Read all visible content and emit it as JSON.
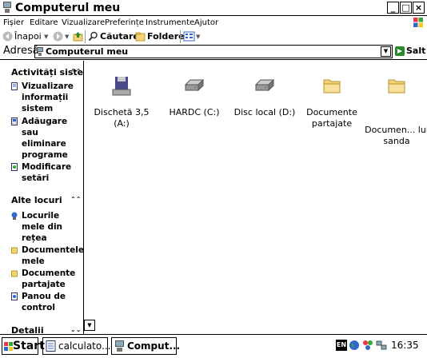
{
  "window": {
    "title": "Computerul meu",
    "buttons": {
      "minimize": "_",
      "maximize": "□",
      "close": "×"
    }
  },
  "menu": {
    "items": [
      "Fișier",
      "Editare",
      "Vizualizare",
      "Preferințe",
      "Instrumente",
      "Ajutor"
    ]
  },
  "toolbar": {
    "back_label": "Înapoi",
    "search_label": "Căutare",
    "folders_label": "Foldere",
    "dropdown_caret": "▼"
  },
  "address": {
    "label": "Adresă",
    "value": "Computerul meu",
    "dropdown_caret": "▼",
    "go_label": "Salt"
  },
  "sidebar": {
    "activities": {
      "title": "Activități sistem",
      "collapse_glyph": "⌃⌃",
      "items": [
        {
          "label": "Vizualizare informații sistem",
          "icon": "info-page-icon"
        },
        {
          "label": "Adăugare sau eliminare programe",
          "icon": "add-remove-icon"
        },
        {
          "label": "Modificare setări",
          "icon": "control-settings-icon"
        }
      ]
    },
    "other_places": {
      "title": "Alte locuri",
      "collapse_glyph": "⌃⌃",
      "items": [
        {
          "label": "Locurile mele din rețea",
          "icon": "network-places-icon"
        },
        {
          "label": "Documentele mele",
          "icon": "my-documents-icon"
        },
        {
          "label": "Documente partajate",
          "icon": "shared-folder-icon"
        },
        {
          "label": "Panou de control",
          "icon": "control-panel-icon"
        }
      ]
    },
    "details": {
      "title": "Detalii",
      "collapse_glyph": "⌄⌄"
    }
  },
  "scrollbar": {
    "down_glyph": "▼"
  },
  "content": {
    "items": [
      {
        "label": "Dischetă 3,5 (A:)",
        "icon": "floppy-drive-icon"
      },
      {
        "label": "HARDC (C:)",
        "icon": "hard-drive-icon"
      },
      {
        "label": "Disc local (D:)",
        "icon": "hard-drive-icon"
      },
      {
        "label": "Documente partajate",
        "icon": "folder-icon"
      },
      {
        "label": "Documen... lui sanda",
        "icon": "folder-icon"
      }
    ]
  },
  "taskbar": {
    "start_label": "Start",
    "tasks": [
      {
        "label": "calculato...",
        "icon": "document-icon"
      },
      {
        "label": "Comput...",
        "icon": "computer-icon"
      }
    ],
    "tray": {
      "language": "EN",
      "clock": "16:35"
    }
  },
  "colors": {
    "folder": "#f4d27a",
    "drive": "#9a9a9a",
    "floppy": "#4a4a8a",
    "go_arrow": "#2a8a2a",
    "back_arrow": "#2a8a2a"
  }
}
